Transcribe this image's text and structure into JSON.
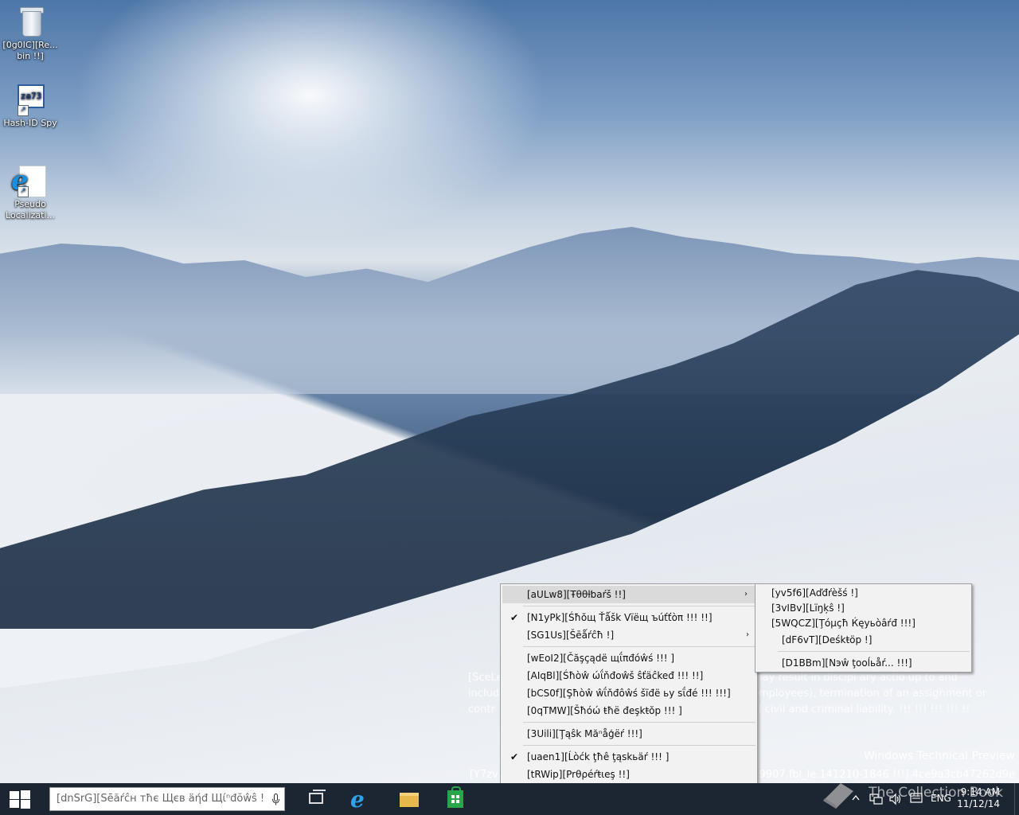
{
  "desktop": {
    "icons": [
      {
        "label_line1": "[0g0IC][Re...",
        "label_line2": "bin !!]"
      },
      {
        "label_line1": "Hash-ID Spy",
        "label_line2": ""
      },
      {
        "label_line1": "Pseudo",
        "label_line2": "Localizati..."
      }
    ],
    "hash_icon_text": "za73",
    "ie_glyph": "e",
    "watermark": {
      "line1_left": "[SceLe",
      "line1_right": "may result in discipl ary actio  up to and",
      "line2_left": "includ",
      "line2_right": "employees), termination of an assignment or",
      "line3_left": "contr",
      "line3_right": "al civil and criminal liability. !!! !!! !!! !!! !!",
      "edition": "Windows Technical Preview",
      "build_left": "[Y7zv",
      "build_right": "9907.fbl_ie.141210-1846 !!!].4ce9a3cb47262d9e"
    },
    "collection_watermark": "The Collection Book"
  },
  "context_menu": {
    "items": [
      {
        "label": "[aULw8][Ŧθθƚƅaŕš !!]",
        "checked": false,
        "submenu": true,
        "highlighted": true
      },
      {
        "label": "[N1yPk][Śħŏщ Ťǻšk Vïëщ ъúťťòπ !!! !!]",
        "checked": true,
        "submenu": false
      },
      {
        "label": "[SG1Us][Šēǻŕĉħ !]",
        "checked": false,
        "submenu": true
      },
      {
        "label": "[wEoI2][Čăşçądë щΐπđόŵś !!! ]",
        "checked": false,
        "submenu": false
      },
      {
        "label": "[AIqBl][Śħòŵ ώΐňđοŵš ŝťäĉkeđ !!! !!]",
        "checked": false,
        "submenu": false
      },
      {
        "label": "[bCS0f][Şħòŵ ŵΐňđôŵś šïđë ьу ѕΐđé !!! !!!]",
        "checked": false,
        "submenu": false
      },
      {
        "label": "[0qTMW][Šħόώ ŧħё đеşkŧŏp !!! ]",
        "checked": false,
        "submenu": false
      },
      {
        "label": "[3Uili][Ţąŝk Măⁿåģёŕ !!!]",
        "checked": false,
        "submenu": false
      },
      {
        "label": "[uaen1][Ĺòćk ţħê ţąskьäŕ !!! ]",
        "checked": true,
        "submenu": false
      },
      {
        "label": "[tRWip][Prθρéŕŧιеş !!]",
        "checked": false,
        "submenu": false
      }
    ],
    "check_glyph": "✔",
    "arrow_glyph": "›"
  },
  "toolbars_submenu": {
    "items": [
      {
        "label": "[yv5f6][Aďđŕèšś !]"
      },
      {
        "label": "[3vIBv][Lïŋķŝ !]"
      },
      {
        "label": "[5WQCZ][Ţόμçħ Ќęуьòâŕđ !!!]"
      },
      {
        "label": "[dF6vT][Deśkŧöp !]"
      },
      {
        "label": "[D1BBm][Nэŵ ţooĺьåŕ... !!!]"
      }
    ]
  },
  "taskbar": {
    "search_placeholder": "[dnSrG][Šēăŕĉн тħє Щєв äήđ Щίⁿđŏŵŝ !",
    "tray": {
      "language": "ENG",
      "time": "9:14 AM",
      "date": "11/12/14"
    }
  },
  "colors": {
    "taskbar": "#1c2632",
    "menu_bg": "#f2f2f2",
    "menu_highlight": "#dadada",
    "store_green": "#29a64a"
  }
}
